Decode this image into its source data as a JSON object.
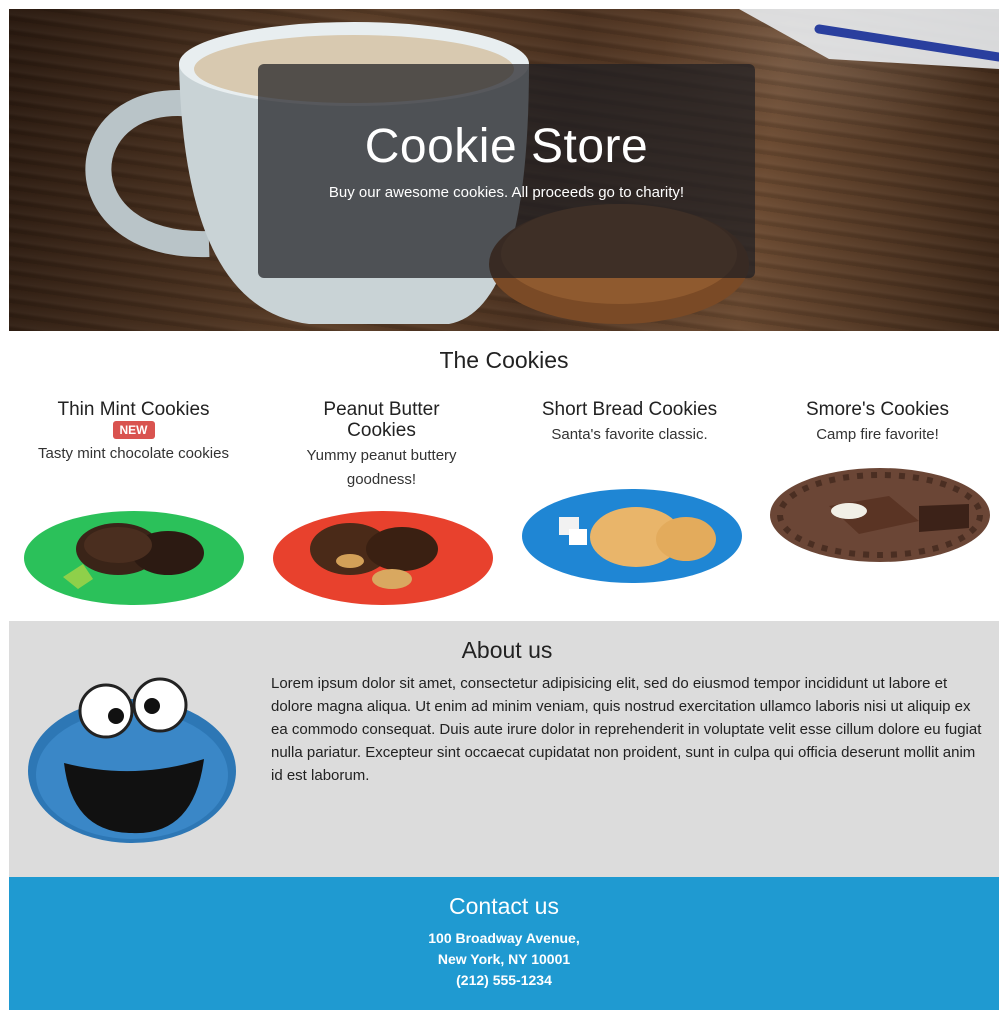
{
  "hero": {
    "title": "Cookie Store",
    "subtitle": "Buy our awesome cookies. All proceeds go to charity!"
  },
  "cookies_section": {
    "title": "The Cookies",
    "items": [
      {
        "name": "Thin Mint Cookies",
        "badge": "NEW",
        "description": "Tasty mint chocolate cookies",
        "plate_color": "#2bc15a"
      },
      {
        "name": "Peanut Butter Cookies",
        "badge": "",
        "description": "Yummy peanut buttery goodness!",
        "plate_color": "#e8412d"
      },
      {
        "name": "Short Bread Cookies",
        "badge": "",
        "description": "Santa's favorite classic.",
        "plate_color": "#1f86d4"
      },
      {
        "name": "Smore's Cookies",
        "badge": "",
        "description": "Camp fire favorite!",
        "plate_color": "#6b4636"
      }
    ]
  },
  "about": {
    "title": "About us",
    "body": "Lorem ipsum dolor sit amet, consectetur adipisicing elit, sed do eiusmod tempor incididunt ut labore et dolore magna aliqua. Ut enim ad minim veniam, quis nostrud exercitation ullamco laboris nisi ut aliquip ex ea commodo consequat. Duis aute irure dolor in reprehenderit in voluptate velit esse cillum dolore eu fugiat nulla pariatur. Excepteur sint occaecat cupidatat non proident, sunt in culpa qui officia deserunt mollit anim id est laborum."
  },
  "contact": {
    "title": "Contact us",
    "address_line1": "100 Broadway Avenue,",
    "address_line2": "New York, NY 10001",
    "phone": "(212) 555-1234"
  },
  "colors": {
    "contact_bg": "#1f9ad1",
    "about_bg": "#dcdcdc",
    "badge": "#d9534f"
  }
}
